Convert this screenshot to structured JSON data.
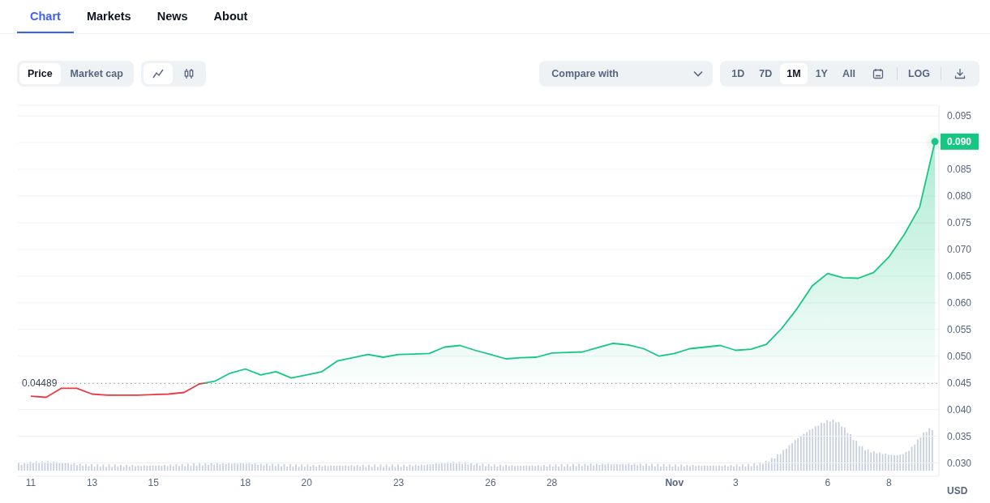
{
  "tabs": [
    {
      "label": "Chart",
      "selected": true
    },
    {
      "label": "Markets",
      "selected": false
    },
    {
      "label": "News",
      "selected": false
    },
    {
      "label": "About",
      "selected": false
    }
  ],
  "metric_toggle": [
    {
      "label": "Price",
      "selected": true
    },
    {
      "label": "Market cap",
      "selected": false
    }
  ],
  "chart_type_toggle": [
    {
      "kind": "line",
      "selected": true
    },
    {
      "kind": "candlestick",
      "selected": false
    }
  ],
  "compare": {
    "placeholder": "Compare with"
  },
  "ranges": [
    {
      "label": "1D",
      "selected": false
    },
    {
      "label": "7D",
      "selected": false
    },
    {
      "label": "1M",
      "selected": true
    },
    {
      "label": "1Y",
      "selected": false
    },
    {
      "label": "All",
      "selected": false
    }
  ],
  "log_button": "LOG",
  "chart": {
    "currency_label": "USD",
    "last_price_label": "0.090",
    "chart_data": {
      "type": "area",
      "grid": true,
      "ylim": [
        0.0275,
        0.097
      ],
      "categories": [
        "11",
        null,
        null,
        null,
        "13",
        null,
        null,
        null,
        "15",
        null,
        null,
        null,
        null,
        null,
        "18",
        null,
        null,
        null,
        "20",
        null,
        null,
        null,
        null,
        null,
        "23",
        null,
        null,
        null,
        null,
        null,
        "26",
        null,
        null,
        null,
        "28",
        null,
        null,
        null,
        null,
        null,
        null,
        null,
        "Nov",
        null,
        null,
        null,
        "3",
        null,
        null,
        null,
        null,
        null,
        "6",
        null,
        null,
        null,
        "8",
        null,
        null,
        null
      ],
      "series": [
        {
          "color": "#16c784",
          "values": [
            0.0425,
            0.0423,
            0.044,
            0.044,
            0.0429,
            0.0427,
            0.0427,
            0.0427,
            0.0428,
            0.0429,
            0.0432,
            0.0448,
            0.0453,
            0.0468,
            0.0476,
            0.0465,
            0.0471,
            0.0459,
            0.0465,
            0.0471,
            0.0491,
            0.0497,
            0.0503,
            0.0498,
            0.0503,
            0.0504,
            0.0505,
            0.0517,
            0.052,
            0.0511,
            0.0503,
            0.0495,
            0.0497,
            0.0498,
            0.0506,
            0.0507,
            0.0508,
            0.0516,
            0.0524,
            0.0521,
            0.0514,
            0.05,
            0.0505,
            0.0514,
            0.0517,
            0.052,
            0.0511,
            0.0513,
            0.0522,
            0.0552,
            0.0589,
            0.0632,
            0.0655,
            0.0647,
            0.0646,
            0.0657,
            0.0686,
            0.0728,
            0.0779,
            0.0902
          ]
        }
      ],
      "yticks": [
        {
          "value": 0.03,
          "label": "0.030"
        },
        {
          "value": 0.035,
          "label": "0.035"
        },
        {
          "value": 0.04,
          "label": "0.040"
        },
        {
          "value": 0.045,
          "label": "0.045"
        },
        {
          "value": 0.05,
          "label": "0.050"
        },
        {
          "value": 0.055,
          "label": "0.055"
        },
        {
          "value": 0.06,
          "label": "0.060"
        },
        {
          "value": 0.065,
          "label": "0.065"
        },
        {
          "value": 0.07,
          "label": "0.070"
        },
        {
          "value": 0.075,
          "label": "0.075"
        },
        {
          "value": 0.08,
          "label": "0.080"
        },
        {
          "value": 0.085,
          "label": "0.085"
        },
        {
          "value": 0.095,
          "label": "0.095"
        }
      ],
      "ref_lines": [
        {
          "axis": "y",
          "value": 0.04489,
          "label": "0.04489"
        }
      ]
    }
  }
}
